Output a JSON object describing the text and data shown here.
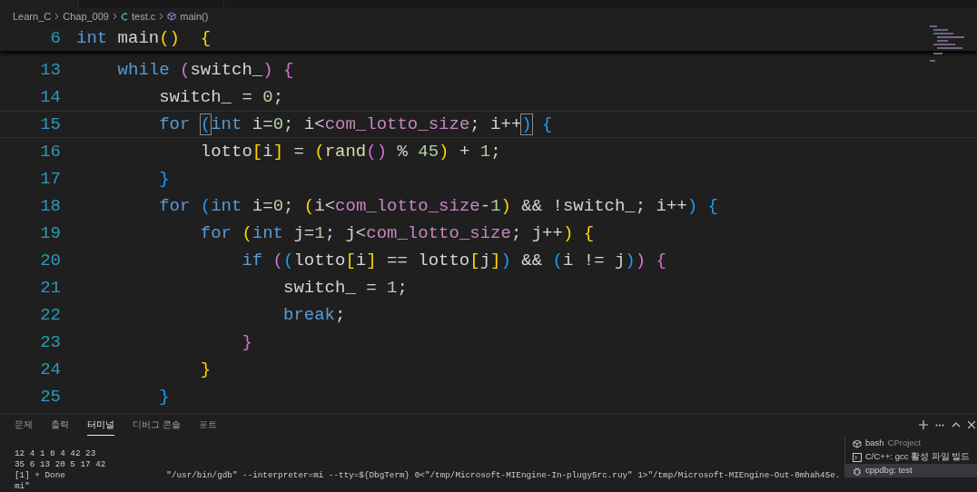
{
  "breadcrumb": [
    {
      "label": "Learn_C",
      "kind": "folder"
    },
    {
      "label": "Chap_009",
      "kind": "folder"
    },
    {
      "label": "test.c",
      "kind": "file"
    },
    {
      "label": "main()",
      "kind": "symbol"
    }
  ],
  "sticky_line": {
    "number": "6",
    "tokens": [
      {
        "t": "int ",
        "kind": "kw"
      },
      {
        "t": "main",
        "kind": "id"
      },
      {
        "t": "()  {",
        "kind": "b1"
      }
    ]
  },
  "lines": [
    {
      "number": "13",
      "current": false,
      "tokens": [
        {
          "t": "while ",
          "kind": "kw"
        },
        {
          "t": "(",
          "kind": "b2"
        },
        {
          "t": "switch_",
          "kind": "id"
        },
        {
          "t": ") {",
          "kind": "b2"
        }
      ],
      "children": [
        {
          "number": "14",
          "current": false,
          "tokens": [
            {
              "t": "switch_ = ",
              "kind": "id"
            },
            {
              "t": "0",
              "kind": "num"
            },
            {
              "t": ";",
              "kind": "id"
            }
          ]
        },
        {
          "number": "15",
          "current": true,
          "tokens": [
            {
              "t": "for ",
              "kind": "kw"
            },
            {
              "t": "(",
              "kind": "b3",
              "match": true
            },
            {
              "t": "int",
              "kind": "kw"
            },
            {
              "t": " i=",
              "kind": "id"
            },
            {
              "t": "0",
              "kind": "num"
            },
            {
              "t": "; i<",
              "kind": "id"
            },
            {
              "t": "com_lotto_size",
              "kind": "macro"
            },
            {
              "t": "; i++",
              "kind": "id"
            },
            {
              "t": ")",
              "kind": "b3",
              "match": true
            },
            {
              "t": " {",
              "kind": "b3"
            }
          ],
          "children": [
            {
              "number": "16",
              "current": false,
              "tokens": [
                {
                  "t": "lotto",
                  "kind": "id"
                },
                {
                  "t": "[",
                  "kind": "b1"
                },
                {
                  "t": "i",
                  "kind": "id"
                },
                {
                  "t": "]",
                  "kind": "b1"
                },
                {
                  "t": " = ",
                  "kind": "id"
                },
                {
                  "t": "(",
                  "kind": "b1"
                },
                {
                  "t": "rand",
                  "kind": "fn"
                },
                {
                  "t": "()",
                  "kind": "b2"
                },
                {
                  "t": " % ",
                  "kind": "id"
                },
                {
                  "t": "45",
                  "kind": "num"
                },
                {
                  "t": ")",
                  "kind": "b1"
                },
                {
                  "t": " + ",
                  "kind": "id"
                },
                {
                  "t": "1",
                  "kind": "num"
                },
                {
                  "t": ";",
                  "kind": "id"
                }
              ]
            }
          ]
        },
        {
          "number": "17",
          "current": false,
          "tokens": [
            {
              "t": "}",
              "kind": "b3"
            }
          ]
        },
        {
          "number": "18",
          "current": false,
          "tokens": [
            {
              "t": "for ",
              "kind": "kw"
            },
            {
              "t": "(",
              "kind": "b3"
            },
            {
              "t": "int",
              "kind": "kw"
            },
            {
              "t": " i=",
              "kind": "id"
            },
            {
              "t": "0",
              "kind": "num"
            },
            {
              "t": "; ",
              "kind": "id"
            },
            {
              "t": "(",
              "kind": "b1"
            },
            {
              "t": "i<",
              "kind": "id"
            },
            {
              "t": "com_lotto_size",
              "kind": "macro"
            },
            {
              "t": "-",
              "kind": "id"
            },
            {
              "t": "1",
              "kind": "num"
            },
            {
              "t": ")",
              "kind": "b1"
            },
            {
              "t": " && !switch_; i++",
              "kind": "id"
            },
            {
              "t": ") {",
              "kind": "b3"
            }
          ],
          "children": [
            {
              "number": "19",
              "current": false,
              "tokens": [
                {
                  "t": "for ",
                  "kind": "kw"
                },
                {
                  "t": "(",
                  "kind": "b1"
                },
                {
                  "t": "int",
                  "kind": "kw"
                },
                {
                  "t": " j=",
                  "kind": "id"
                },
                {
                  "t": "1",
                  "kind": "num"
                },
                {
                  "t": "; j<",
                  "kind": "id"
                },
                {
                  "t": "com_lotto_size",
                  "kind": "macro"
                },
                {
                  "t": "; j++",
                  "kind": "id"
                },
                {
                  "t": ") {",
                  "kind": "b1"
                }
              ],
              "children": [
                {
                  "number": "20",
                  "current": false,
                  "tokens": [
                    {
                      "t": "if ",
                      "kind": "kw"
                    },
                    {
                      "t": "(",
                      "kind": "b2"
                    },
                    {
                      "t": "(",
                      "kind": "b3"
                    },
                    {
                      "t": "lotto",
                      "kind": "id"
                    },
                    {
                      "t": "[",
                      "kind": "b1"
                    },
                    {
                      "t": "i",
                      "kind": "id"
                    },
                    {
                      "t": "]",
                      "kind": "b1"
                    },
                    {
                      "t": " == lotto",
                      "kind": "id"
                    },
                    {
                      "t": "[",
                      "kind": "b1"
                    },
                    {
                      "t": "j",
                      "kind": "id"
                    },
                    {
                      "t": "]",
                      "kind": "b1"
                    },
                    {
                      "t": ")",
                      "kind": "b3"
                    },
                    {
                      "t": " && ",
                      "kind": "id"
                    },
                    {
                      "t": "(",
                      "kind": "b3"
                    },
                    {
                      "t": "i != j",
                      "kind": "id"
                    },
                    {
                      "t": ")",
                      "kind": "b3"
                    },
                    {
                      "t": ") {",
                      "kind": "b2"
                    }
                  ],
                  "children": [
                    {
                      "number": "21",
                      "current": false,
                      "tokens": [
                        {
                          "t": "switch_ = ",
                          "kind": "id"
                        },
                        {
                          "t": "1",
                          "kind": "num"
                        },
                        {
                          "t": ";",
                          "kind": "id"
                        }
                      ]
                    },
                    {
                      "number": "22",
                      "current": false,
                      "tokens": [
                        {
                          "t": "break",
                          "kind": "kw"
                        },
                        {
                          "t": ";",
                          "kind": "id"
                        }
                      ]
                    }
                  ]
                },
                {
                  "number": "23",
                  "current": false,
                  "tokens": [
                    {
                      "t": "}",
                      "kind": "b2"
                    }
                  ]
                }
              ]
            },
            {
              "number": "24",
              "current": false,
              "tokens": [
                {
                  "t": "}",
                  "kind": "b1"
                }
              ]
            }
          ]
        },
        {
          "number": "25",
          "current": false,
          "tokens": [
            {
              "t": "}",
              "kind": "b3"
            }
          ]
        }
      ]
    }
  ],
  "panel_tabs": [
    {
      "label": "문제",
      "selected": false
    },
    {
      "label": "출력",
      "selected": false
    },
    {
      "label": "터미널",
      "selected": true
    },
    {
      "label": "디버그 콘솔",
      "selected": false
    },
    {
      "label": "포트",
      "selected": false
    }
  ],
  "terminal_lines": [
    "12 4 1 8 4 42 23",
    "35 6 13 20 5 17 42",
    "[1] + Done                    \"/usr/bin/gdb\" --interpreter=mi --tty=${DbgTerm} 0<\"/tmp/Microsoft-MIEngine-In-plugy5rc.ruy\" 1>\"/tmp/Microsoft-MIEngine-Out-0mhah45e.",
    "mi\""
  ],
  "terminals": [
    {
      "kind": "shell",
      "name": "bash",
      "detail": "CProject",
      "selected": false
    },
    {
      "kind": "task",
      "name": "C/C++: gcc 활성 파일 빌드",
      "selected": false
    },
    {
      "kind": "debug",
      "name": "cppdbg: test",
      "selected": true
    }
  ]
}
